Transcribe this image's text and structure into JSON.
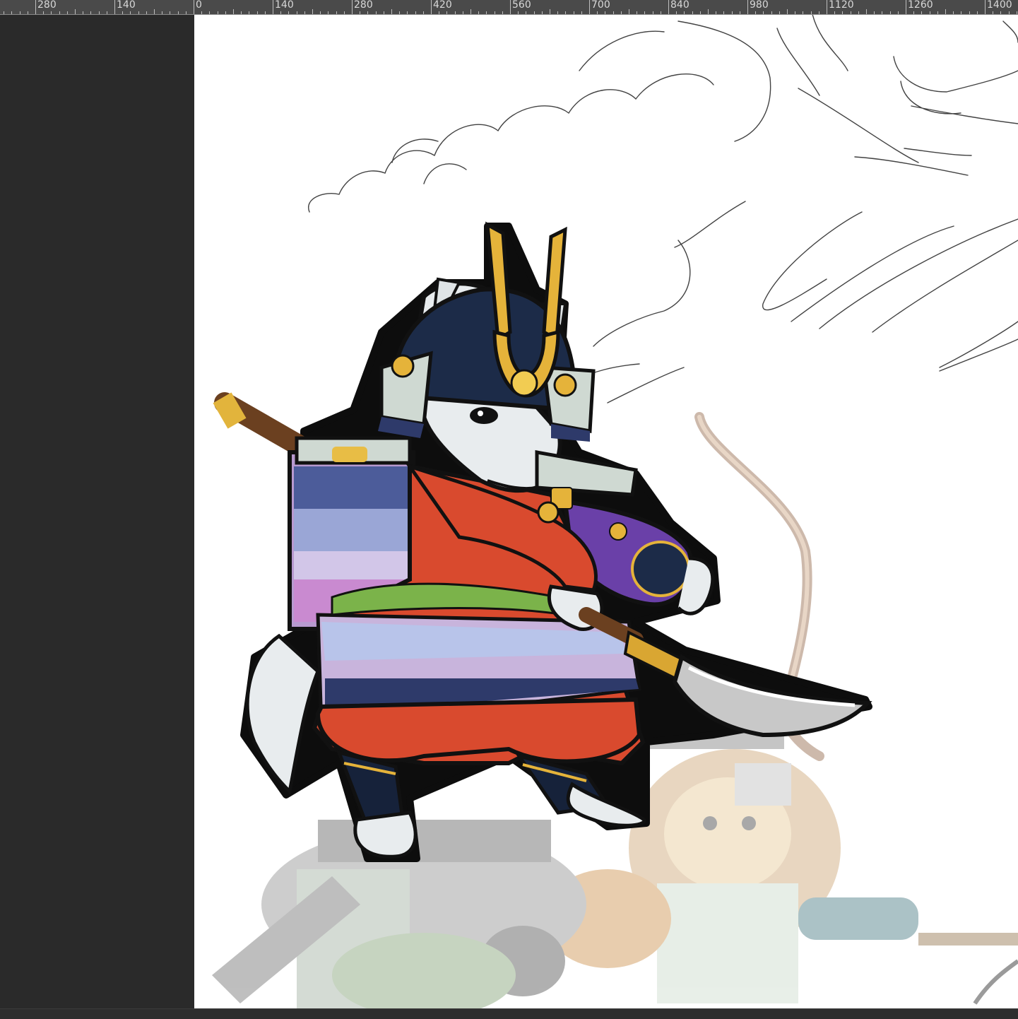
{
  "ruler": {
    "labels": [
      "280",
      "140",
      "0",
      "140",
      "280",
      "420",
      "560",
      "700",
      "840",
      "980",
      "1120",
      "1260",
      "1400"
    ]
  },
  "canvas": {
    "background": "#ffffff",
    "artwork": "samurai-wolf-illustration"
  },
  "colors": {
    "ruler_bg": "#4a4a4a",
    "pasteboard": "#2a2a2a",
    "armor_red": "#d94a2e",
    "armor_navy": "#1c2b48",
    "armor_lavender": "#b89ad0",
    "gold": "#e5b33a"
  }
}
